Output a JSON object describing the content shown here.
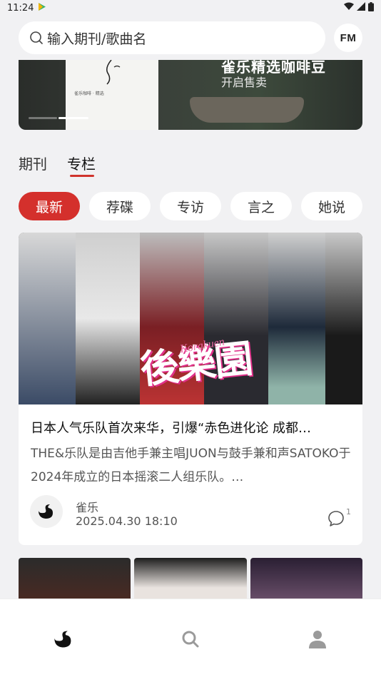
{
  "status": {
    "time": "11:24"
  },
  "search": {
    "placeholder": "输入期刊/歌曲名",
    "fm_label": "FM"
  },
  "banner": {
    "title": "雀乐精选咖啡豆",
    "subtitle": "开启售卖",
    "bag_text": "雀乐咖啡 · 精选"
  },
  "main_tabs": [
    {
      "label": "期刊",
      "active": false
    },
    {
      "label": "专栏",
      "active": true
    }
  ],
  "categories": [
    {
      "label": "最新",
      "active": true
    },
    {
      "label": "荐碟",
      "active": false
    },
    {
      "label": "专访",
      "active": false
    },
    {
      "label": "言之",
      "active": false
    },
    {
      "label": "她说",
      "active": false
    }
  ],
  "article": {
    "cover_logo": "後樂園",
    "cover_script": "Korakuen",
    "title": "日本人气乐队首次来华，引爆“赤色进化论 成都…",
    "description": "THE&乐队是由吉他手兼主唱JUON与鼓手兼和声SATOKO于2024年成立的日本摇滚二人组乐队。…",
    "author": "雀乐",
    "datetime": "2025.04.30 18:10",
    "comment_count": "1"
  },
  "bottom_nav": [
    {
      "icon": "swan-logo-icon",
      "active": true
    },
    {
      "icon": "search-icon",
      "active": false
    },
    {
      "icon": "profile-icon",
      "active": false
    }
  ],
  "colors": {
    "accent": "#d4302c",
    "background": "#f1f1f3"
  }
}
